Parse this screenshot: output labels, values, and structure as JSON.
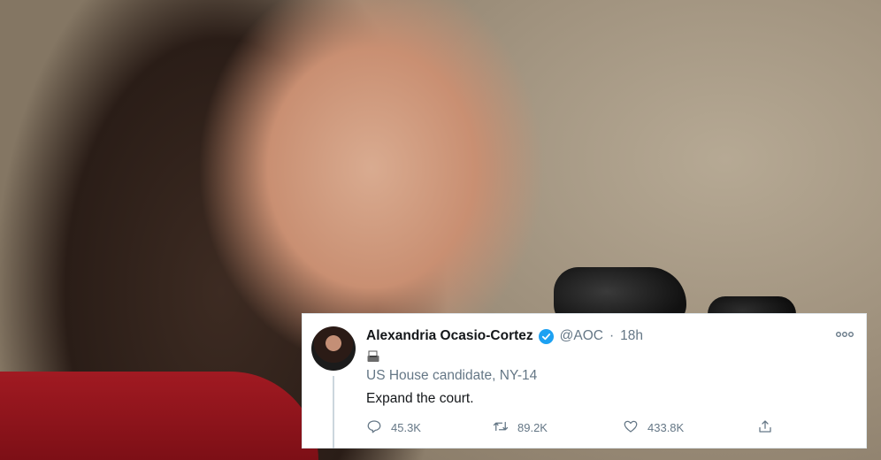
{
  "tweet": {
    "author_name": "Alexandria Ocasio-Cortez",
    "handle": "@AOC",
    "separator": "·",
    "time": "18h",
    "more_icon": "more-horizontal-icon",
    "bio_icon": "ballot-box-icon",
    "bio": "US House candidate, NY-14",
    "text": "Expand the court.",
    "replies": "45.3K",
    "retweets": "89.2K",
    "likes": "433.8K",
    "verified_color": "#1da1f2",
    "icons": [
      "reply-icon",
      "retweet-icon",
      "like-icon",
      "share-icon"
    ]
  }
}
